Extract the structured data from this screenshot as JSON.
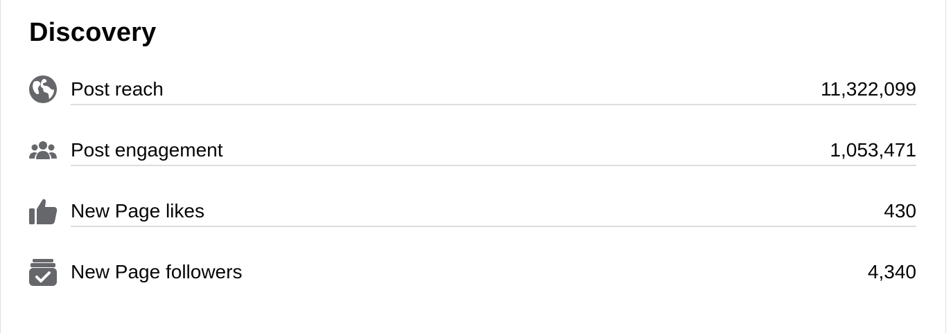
{
  "section": {
    "title": "Discovery"
  },
  "metrics": [
    {
      "icon": "globe-icon",
      "label": "Post reach",
      "value": "11,322,099"
    },
    {
      "icon": "people-group-icon",
      "label": "Post engagement",
      "value": "1,053,471"
    },
    {
      "icon": "thumbs-up-icon",
      "label": "New Page likes",
      "value": "430"
    },
    {
      "icon": "follow-checkbox-icon",
      "label": "New Page followers",
      "value": "4,340"
    }
  ],
  "colors": {
    "icon": "#65676b",
    "text": "#050505",
    "divider": "#dadde1"
  }
}
